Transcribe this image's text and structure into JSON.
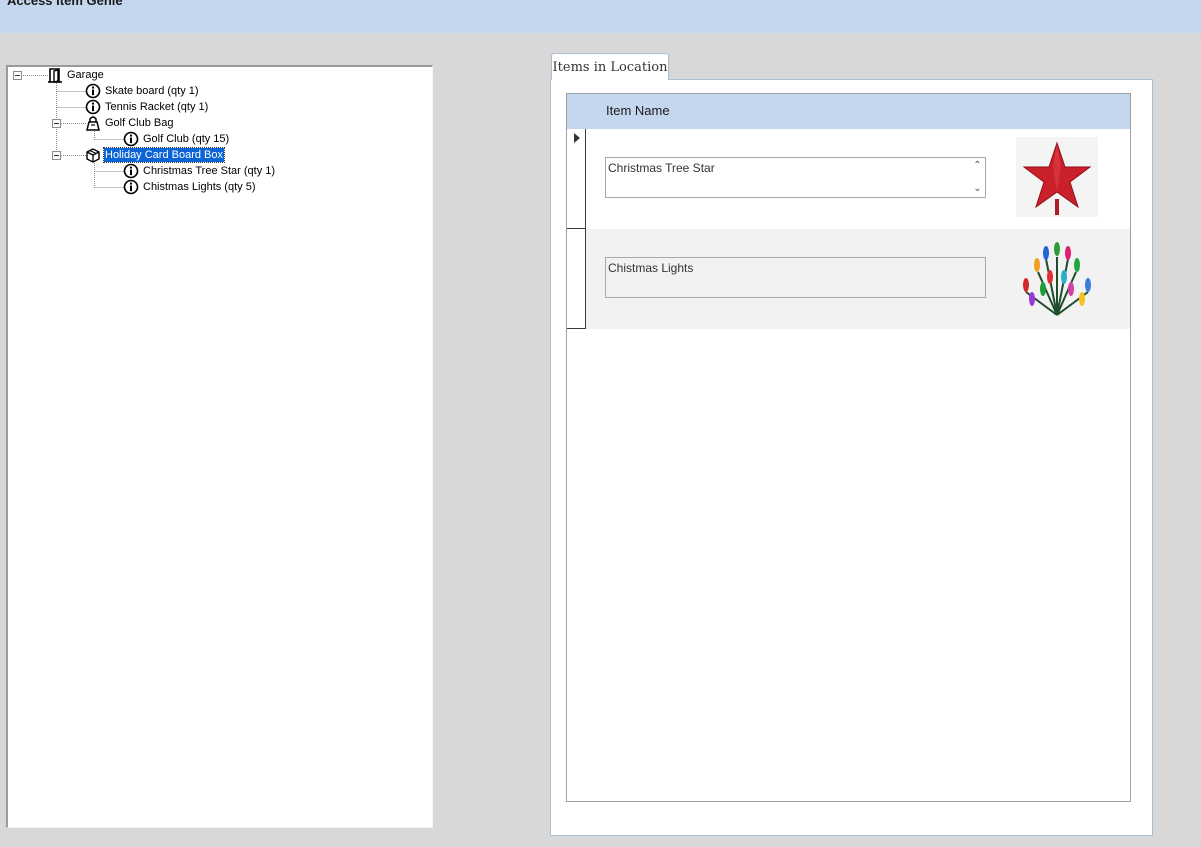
{
  "app": {
    "title": "Access Item Genie"
  },
  "tree": {
    "nodes": [
      {
        "label": "Garage",
        "icon": "door-icon",
        "expander": "minus"
      },
      {
        "label": "Skate board (qty 1)",
        "icon": "info-icon"
      },
      {
        "label": "Tennis Racket (qty 1)",
        "icon": "info-icon"
      },
      {
        "label": "Golf Club Bag",
        "icon": "bag-icon",
        "expander": "minus"
      },
      {
        "label": "Golf Club (qty 15)",
        "icon": "info-icon"
      },
      {
        "label": "Holiday Card Board Box",
        "icon": "box-icon",
        "expander": "minus",
        "selected": true
      },
      {
        "label": "Christmas Tree Star (qty 1)",
        "icon": "info-icon"
      },
      {
        "label": "Chistmas Lights (qty 5)",
        "icon": "info-icon"
      }
    ]
  },
  "tab": {
    "label": "Items in Location"
  },
  "subform": {
    "header": "Item Name",
    "rows": [
      {
        "name": "Christmas Tree Star",
        "image": "star-ornament-icon",
        "current": true
      },
      {
        "name": "Chistmas Lights",
        "image": "string-lights-icon",
        "current": false
      }
    ]
  },
  "colors": {
    "header_bg": "#c5d7ee",
    "selection": "#0a64d6",
    "star_red": "#c9202a"
  }
}
